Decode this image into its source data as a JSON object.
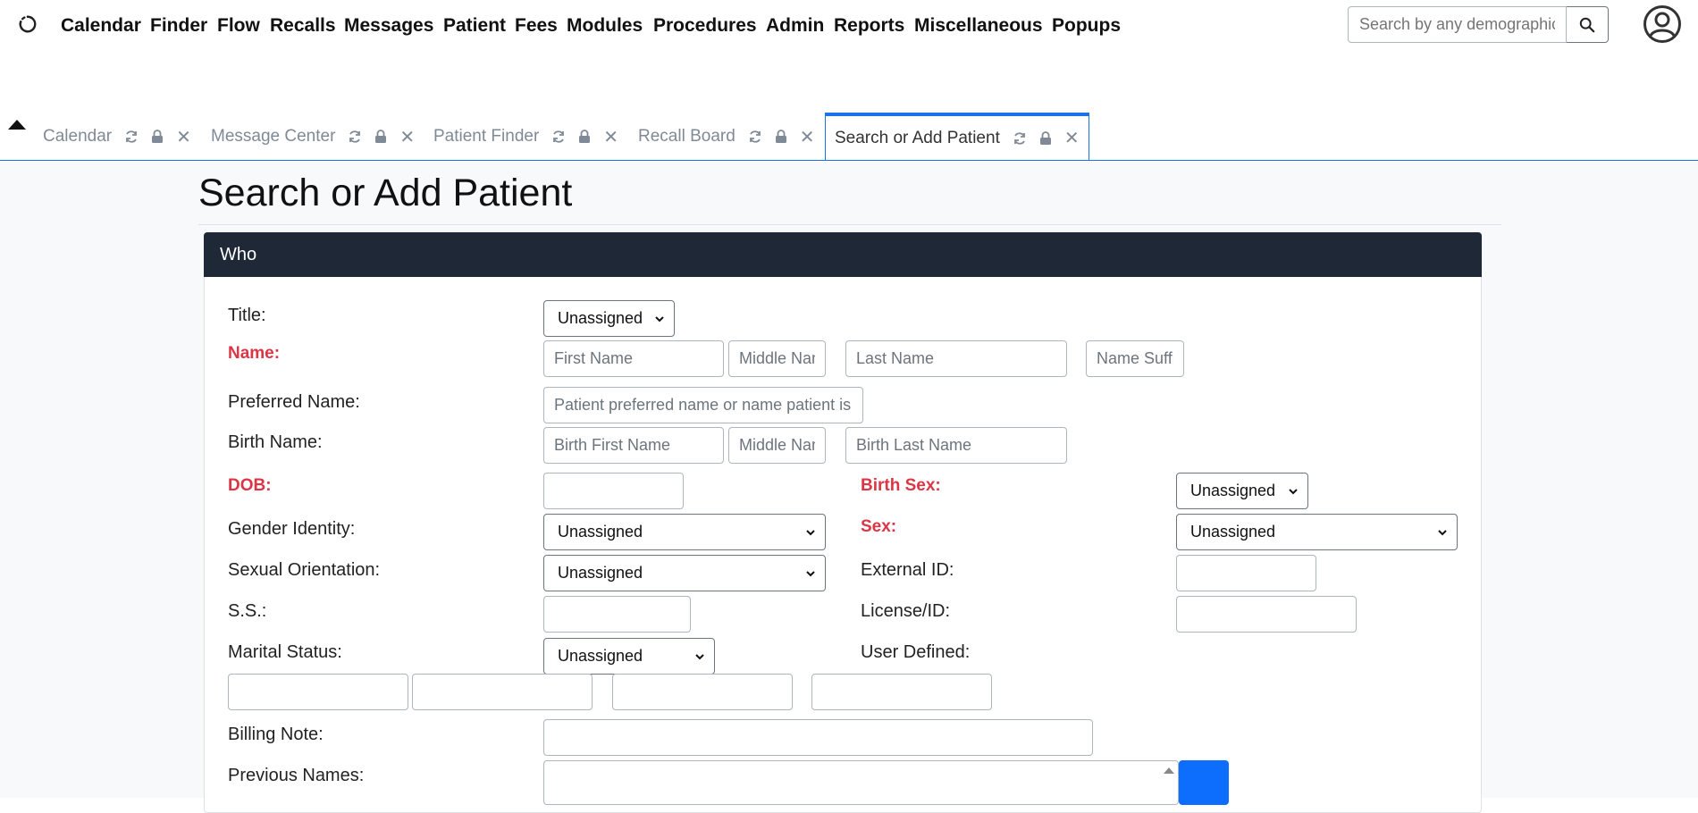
{
  "nav": {
    "items": [
      "Calendar",
      "Finder",
      "Flow",
      "Recalls",
      "Messages",
      "Patient",
      "Fees",
      "Modules",
      "Procedures",
      "Admin",
      "Reports",
      "Miscellaneous",
      "Popups"
    ],
    "search_placeholder": "Search by any demographics"
  },
  "tabs": [
    {
      "label": "Calendar",
      "active": false
    },
    {
      "label": "Message Center",
      "active": false
    },
    {
      "label": "Patient Finder",
      "active": false
    },
    {
      "label": "Recall Board",
      "active": false
    },
    {
      "label": "Search or Add Patient",
      "active": true
    }
  ],
  "page": {
    "title": "Search or Add Patient",
    "section_header": "Who"
  },
  "form": {
    "title_label": "Title:",
    "title_value": "Unassigned",
    "name_label": "Name:",
    "first_name_placeholder": "First Name",
    "middle_name_placeholder": "Middle Name",
    "last_name_placeholder": "Last Name",
    "name_suffix_placeholder": "Name Suffix",
    "preferred_name_label": "Preferred Name:",
    "preferred_name_placeholder": "Patient preferred name or name patient is commonly known",
    "birth_name_label": "Birth Name:",
    "birth_first_placeholder": "Birth First Name",
    "birth_middle_placeholder": "Middle Name",
    "birth_last_placeholder": "Birth Last Name",
    "dob_label": "DOB:",
    "birth_sex_label": "Birth Sex:",
    "birth_sex_value": "Unassigned",
    "gender_identity_label": "Gender Identity:",
    "gender_identity_value": "Unassigned",
    "sex_label": "Sex:",
    "sex_value": "Unassigned",
    "sexual_orientation_label": "Sexual Orientation:",
    "sexual_orientation_value": "Unassigned",
    "external_id_label": "External ID:",
    "ss_label": "S.S.:",
    "license_label": "License/ID:",
    "marital_status_label": "Marital Status:",
    "marital_status_value": "Unassigned",
    "user_defined_label": "User Defined:",
    "billing_note_label": "Billing Note:",
    "previous_names_label": "Previous Names:"
  },
  "colors": {
    "accent": "#1a73e8",
    "header_bg": "#1e2837",
    "required": "#dc3545",
    "button": "#0d6efd"
  }
}
